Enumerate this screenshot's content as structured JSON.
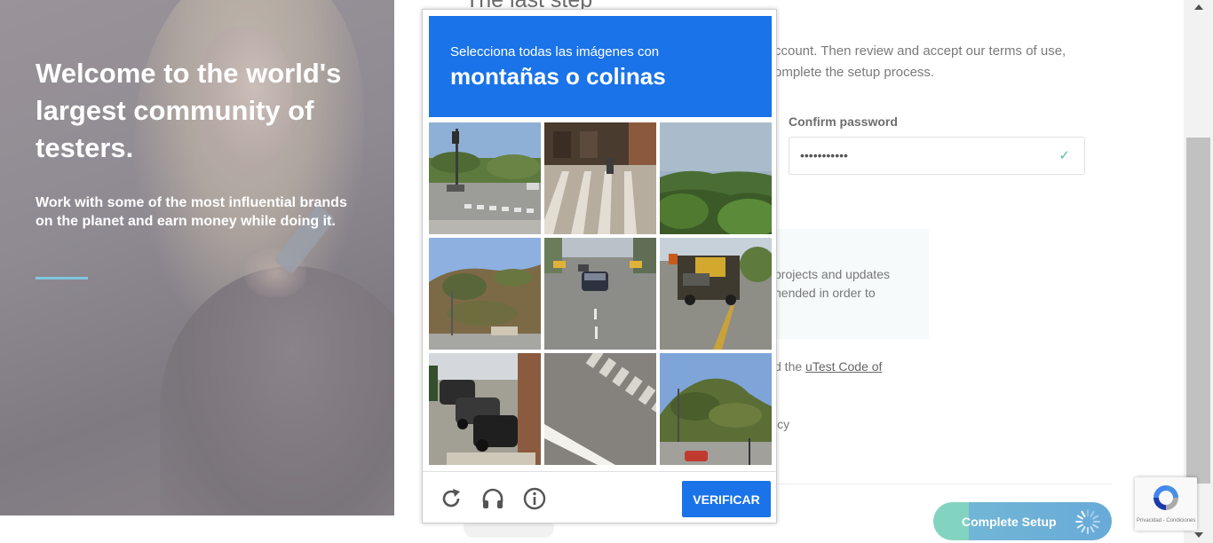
{
  "hero": {
    "title": "Welcome to the world's largest community of testers.",
    "subtitle": "Work with some of the most influential brands on the planet and earn money while doing it."
  },
  "background_page": {
    "heading": "The last step",
    "intro": "ccount. Then review and accept our terms of use, omplete the setup process.",
    "confirm_password_label": "Confirm password",
    "confirm_password_value": "•••••••••••",
    "info_text": "projects and updates nended in order to",
    "code_prefix": "d the ",
    "code_link": "uTest Code of",
    "privacy_text": "icy",
    "complete_button": "Complete Setup"
  },
  "captcha": {
    "instruction": "Selecciona todas las imágenes con",
    "target": "montañas o colinas",
    "verify_button": "VERIFICAR",
    "tiles": [
      {
        "scene": "intersection-crosswalk"
      },
      {
        "scene": "sidewalk-crosswalk-building"
      },
      {
        "scene": "green-hills"
      },
      {
        "scene": "hillside-road"
      },
      {
        "scene": "street-traffic"
      },
      {
        "scene": "truck-road"
      },
      {
        "scene": "parked-cars"
      },
      {
        "scene": "crosswalk-closeup"
      },
      {
        "scene": "hill-intersection"
      }
    ]
  },
  "recaptcha_badge": {
    "terms": "Privacidad - Condiciones"
  },
  "colors": {
    "captcha_blue": "#1a73e8",
    "accent_teal": "#82d4c0",
    "accent_blue": "#68aad8",
    "hero_rule": "#7fc6dc"
  }
}
